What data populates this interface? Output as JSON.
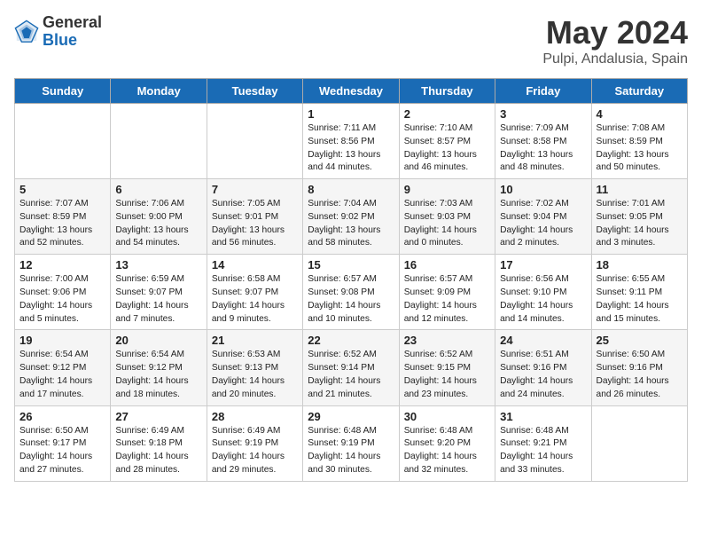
{
  "header": {
    "logo_general": "General",
    "logo_blue": "Blue",
    "month_title": "May 2024",
    "location": "Pulpi, Andalusia, Spain"
  },
  "weekdays": [
    "Sunday",
    "Monday",
    "Tuesday",
    "Wednesday",
    "Thursday",
    "Friday",
    "Saturday"
  ],
  "weeks": [
    [
      {
        "day": "",
        "info": ""
      },
      {
        "day": "",
        "info": ""
      },
      {
        "day": "",
        "info": ""
      },
      {
        "day": "1",
        "info": "Sunrise: 7:11 AM\nSunset: 8:56 PM\nDaylight: 13 hours\nand 44 minutes."
      },
      {
        "day": "2",
        "info": "Sunrise: 7:10 AM\nSunset: 8:57 PM\nDaylight: 13 hours\nand 46 minutes."
      },
      {
        "day": "3",
        "info": "Sunrise: 7:09 AM\nSunset: 8:58 PM\nDaylight: 13 hours\nand 48 minutes."
      },
      {
        "day": "4",
        "info": "Sunrise: 7:08 AM\nSunset: 8:59 PM\nDaylight: 13 hours\nand 50 minutes."
      }
    ],
    [
      {
        "day": "5",
        "info": "Sunrise: 7:07 AM\nSunset: 8:59 PM\nDaylight: 13 hours\nand 52 minutes."
      },
      {
        "day": "6",
        "info": "Sunrise: 7:06 AM\nSunset: 9:00 PM\nDaylight: 13 hours\nand 54 minutes."
      },
      {
        "day": "7",
        "info": "Sunrise: 7:05 AM\nSunset: 9:01 PM\nDaylight: 13 hours\nand 56 minutes."
      },
      {
        "day": "8",
        "info": "Sunrise: 7:04 AM\nSunset: 9:02 PM\nDaylight: 13 hours\nand 58 minutes."
      },
      {
        "day": "9",
        "info": "Sunrise: 7:03 AM\nSunset: 9:03 PM\nDaylight: 14 hours\nand 0 minutes."
      },
      {
        "day": "10",
        "info": "Sunrise: 7:02 AM\nSunset: 9:04 PM\nDaylight: 14 hours\nand 2 minutes."
      },
      {
        "day": "11",
        "info": "Sunrise: 7:01 AM\nSunset: 9:05 PM\nDaylight: 14 hours\nand 3 minutes."
      }
    ],
    [
      {
        "day": "12",
        "info": "Sunrise: 7:00 AM\nSunset: 9:06 PM\nDaylight: 14 hours\nand 5 minutes."
      },
      {
        "day": "13",
        "info": "Sunrise: 6:59 AM\nSunset: 9:07 PM\nDaylight: 14 hours\nand 7 minutes."
      },
      {
        "day": "14",
        "info": "Sunrise: 6:58 AM\nSunset: 9:07 PM\nDaylight: 14 hours\nand 9 minutes."
      },
      {
        "day": "15",
        "info": "Sunrise: 6:57 AM\nSunset: 9:08 PM\nDaylight: 14 hours\nand 10 minutes."
      },
      {
        "day": "16",
        "info": "Sunrise: 6:57 AM\nSunset: 9:09 PM\nDaylight: 14 hours\nand 12 minutes."
      },
      {
        "day": "17",
        "info": "Sunrise: 6:56 AM\nSunset: 9:10 PM\nDaylight: 14 hours\nand 14 minutes."
      },
      {
        "day": "18",
        "info": "Sunrise: 6:55 AM\nSunset: 9:11 PM\nDaylight: 14 hours\nand 15 minutes."
      }
    ],
    [
      {
        "day": "19",
        "info": "Sunrise: 6:54 AM\nSunset: 9:12 PM\nDaylight: 14 hours\nand 17 minutes."
      },
      {
        "day": "20",
        "info": "Sunrise: 6:54 AM\nSunset: 9:12 PM\nDaylight: 14 hours\nand 18 minutes."
      },
      {
        "day": "21",
        "info": "Sunrise: 6:53 AM\nSunset: 9:13 PM\nDaylight: 14 hours\nand 20 minutes."
      },
      {
        "day": "22",
        "info": "Sunrise: 6:52 AM\nSunset: 9:14 PM\nDaylight: 14 hours\nand 21 minutes."
      },
      {
        "day": "23",
        "info": "Sunrise: 6:52 AM\nSunset: 9:15 PM\nDaylight: 14 hours\nand 23 minutes."
      },
      {
        "day": "24",
        "info": "Sunrise: 6:51 AM\nSunset: 9:16 PM\nDaylight: 14 hours\nand 24 minutes."
      },
      {
        "day": "25",
        "info": "Sunrise: 6:50 AM\nSunset: 9:16 PM\nDaylight: 14 hours\nand 26 minutes."
      }
    ],
    [
      {
        "day": "26",
        "info": "Sunrise: 6:50 AM\nSunset: 9:17 PM\nDaylight: 14 hours\nand 27 minutes."
      },
      {
        "day": "27",
        "info": "Sunrise: 6:49 AM\nSunset: 9:18 PM\nDaylight: 14 hours\nand 28 minutes."
      },
      {
        "day": "28",
        "info": "Sunrise: 6:49 AM\nSunset: 9:19 PM\nDaylight: 14 hours\nand 29 minutes."
      },
      {
        "day": "29",
        "info": "Sunrise: 6:48 AM\nSunset: 9:19 PM\nDaylight: 14 hours\nand 30 minutes."
      },
      {
        "day": "30",
        "info": "Sunrise: 6:48 AM\nSunset: 9:20 PM\nDaylight: 14 hours\nand 32 minutes."
      },
      {
        "day": "31",
        "info": "Sunrise: 6:48 AM\nSunset: 9:21 PM\nDaylight: 14 hours\nand 33 minutes."
      },
      {
        "day": "",
        "info": ""
      }
    ]
  ]
}
